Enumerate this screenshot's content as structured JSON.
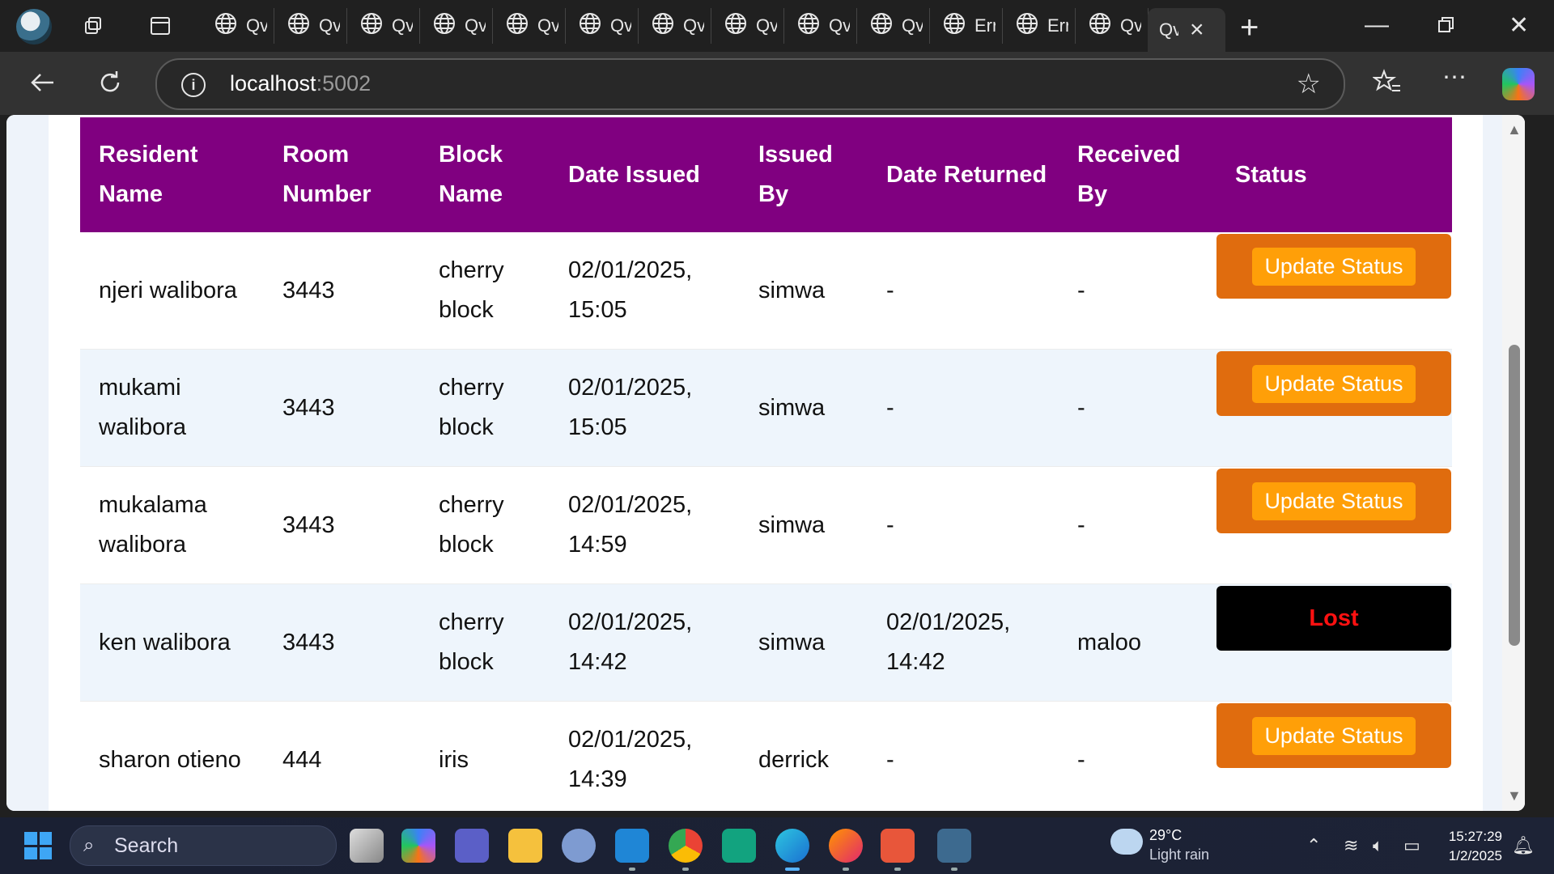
{
  "browser": {
    "tabs": [
      {
        "title": "Qv"
      },
      {
        "title": "Qv"
      },
      {
        "title": "Qv"
      },
      {
        "title": "Qv"
      },
      {
        "title": "Qv"
      },
      {
        "title": "Qv"
      },
      {
        "title": "Qv"
      },
      {
        "title": "Qv"
      },
      {
        "title": "Qv"
      },
      {
        "title": "Qv"
      },
      {
        "title": "Err"
      },
      {
        "title": "Err"
      },
      {
        "title": "Qv"
      }
    ],
    "active_tab": {
      "title": "Qv"
    },
    "url_host": "localhost",
    "url_port": ":5002"
  },
  "table": {
    "headers": {
      "resident_name": "Resident Name",
      "room_number": "Room Number",
      "block_name": "Block Name",
      "date_issued": "Date Issued",
      "issued_by": "Issued By",
      "date_returned": "Date Returned",
      "received_by": "Received By",
      "status": "Status"
    },
    "rows": [
      {
        "resident": "njeri walibora",
        "room": "3443",
        "block": "cherry block",
        "date_issued": "02/01/2025, 15:05",
        "issued_by": "simwa",
        "date_returned": "-",
        "received_by": "-",
        "status": "Update Status"
      },
      {
        "resident": "mukami walibora",
        "room": "3443",
        "block": "cherry block",
        "date_issued": "02/01/2025, 15:05",
        "issued_by": "simwa",
        "date_returned": "-",
        "received_by": "-",
        "status": "Update Status"
      },
      {
        "resident": "mukalama walibora",
        "room": "3443",
        "block": "cherry block",
        "date_issued": "02/01/2025, 14:59",
        "issued_by": "simwa",
        "date_returned": "-",
        "received_by": "-",
        "status": "Update Status"
      },
      {
        "resident": "ken walibora",
        "room": "3443",
        "block": "cherry block",
        "date_issued": "02/01/2025, 14:42",
        "issued_by": "simwa",
        "date_returned": "02/01/2025, 14:42",
        "received_by": "maloo",
        "status": "Lost"
      },
      {
        "resident": "sharon otieno",
        "room": "444",
        "block": "iris",
        "date_issued": "02/01/2025, 14:39",
        "issued_by": "derrick",
        "date_returned": "-",
        "received_by": "-",
        "status": "Update Status"
      }
    ]
  },
  "colors": {
    "header_bg": "#800080",
    "status_box": "#e06c0e",
    "status_button": "#ff9f08",
    "lost_bg": "#000000",
    "lost_text": "#ff1111"
  },
  "taskbar": {
    "search_label": "Search",
    "weather_temp": "29°C",
    "weather_cond": "Light rain",
    "time": "15:27:29",
    "date": "1/2/2025"
  }
}
